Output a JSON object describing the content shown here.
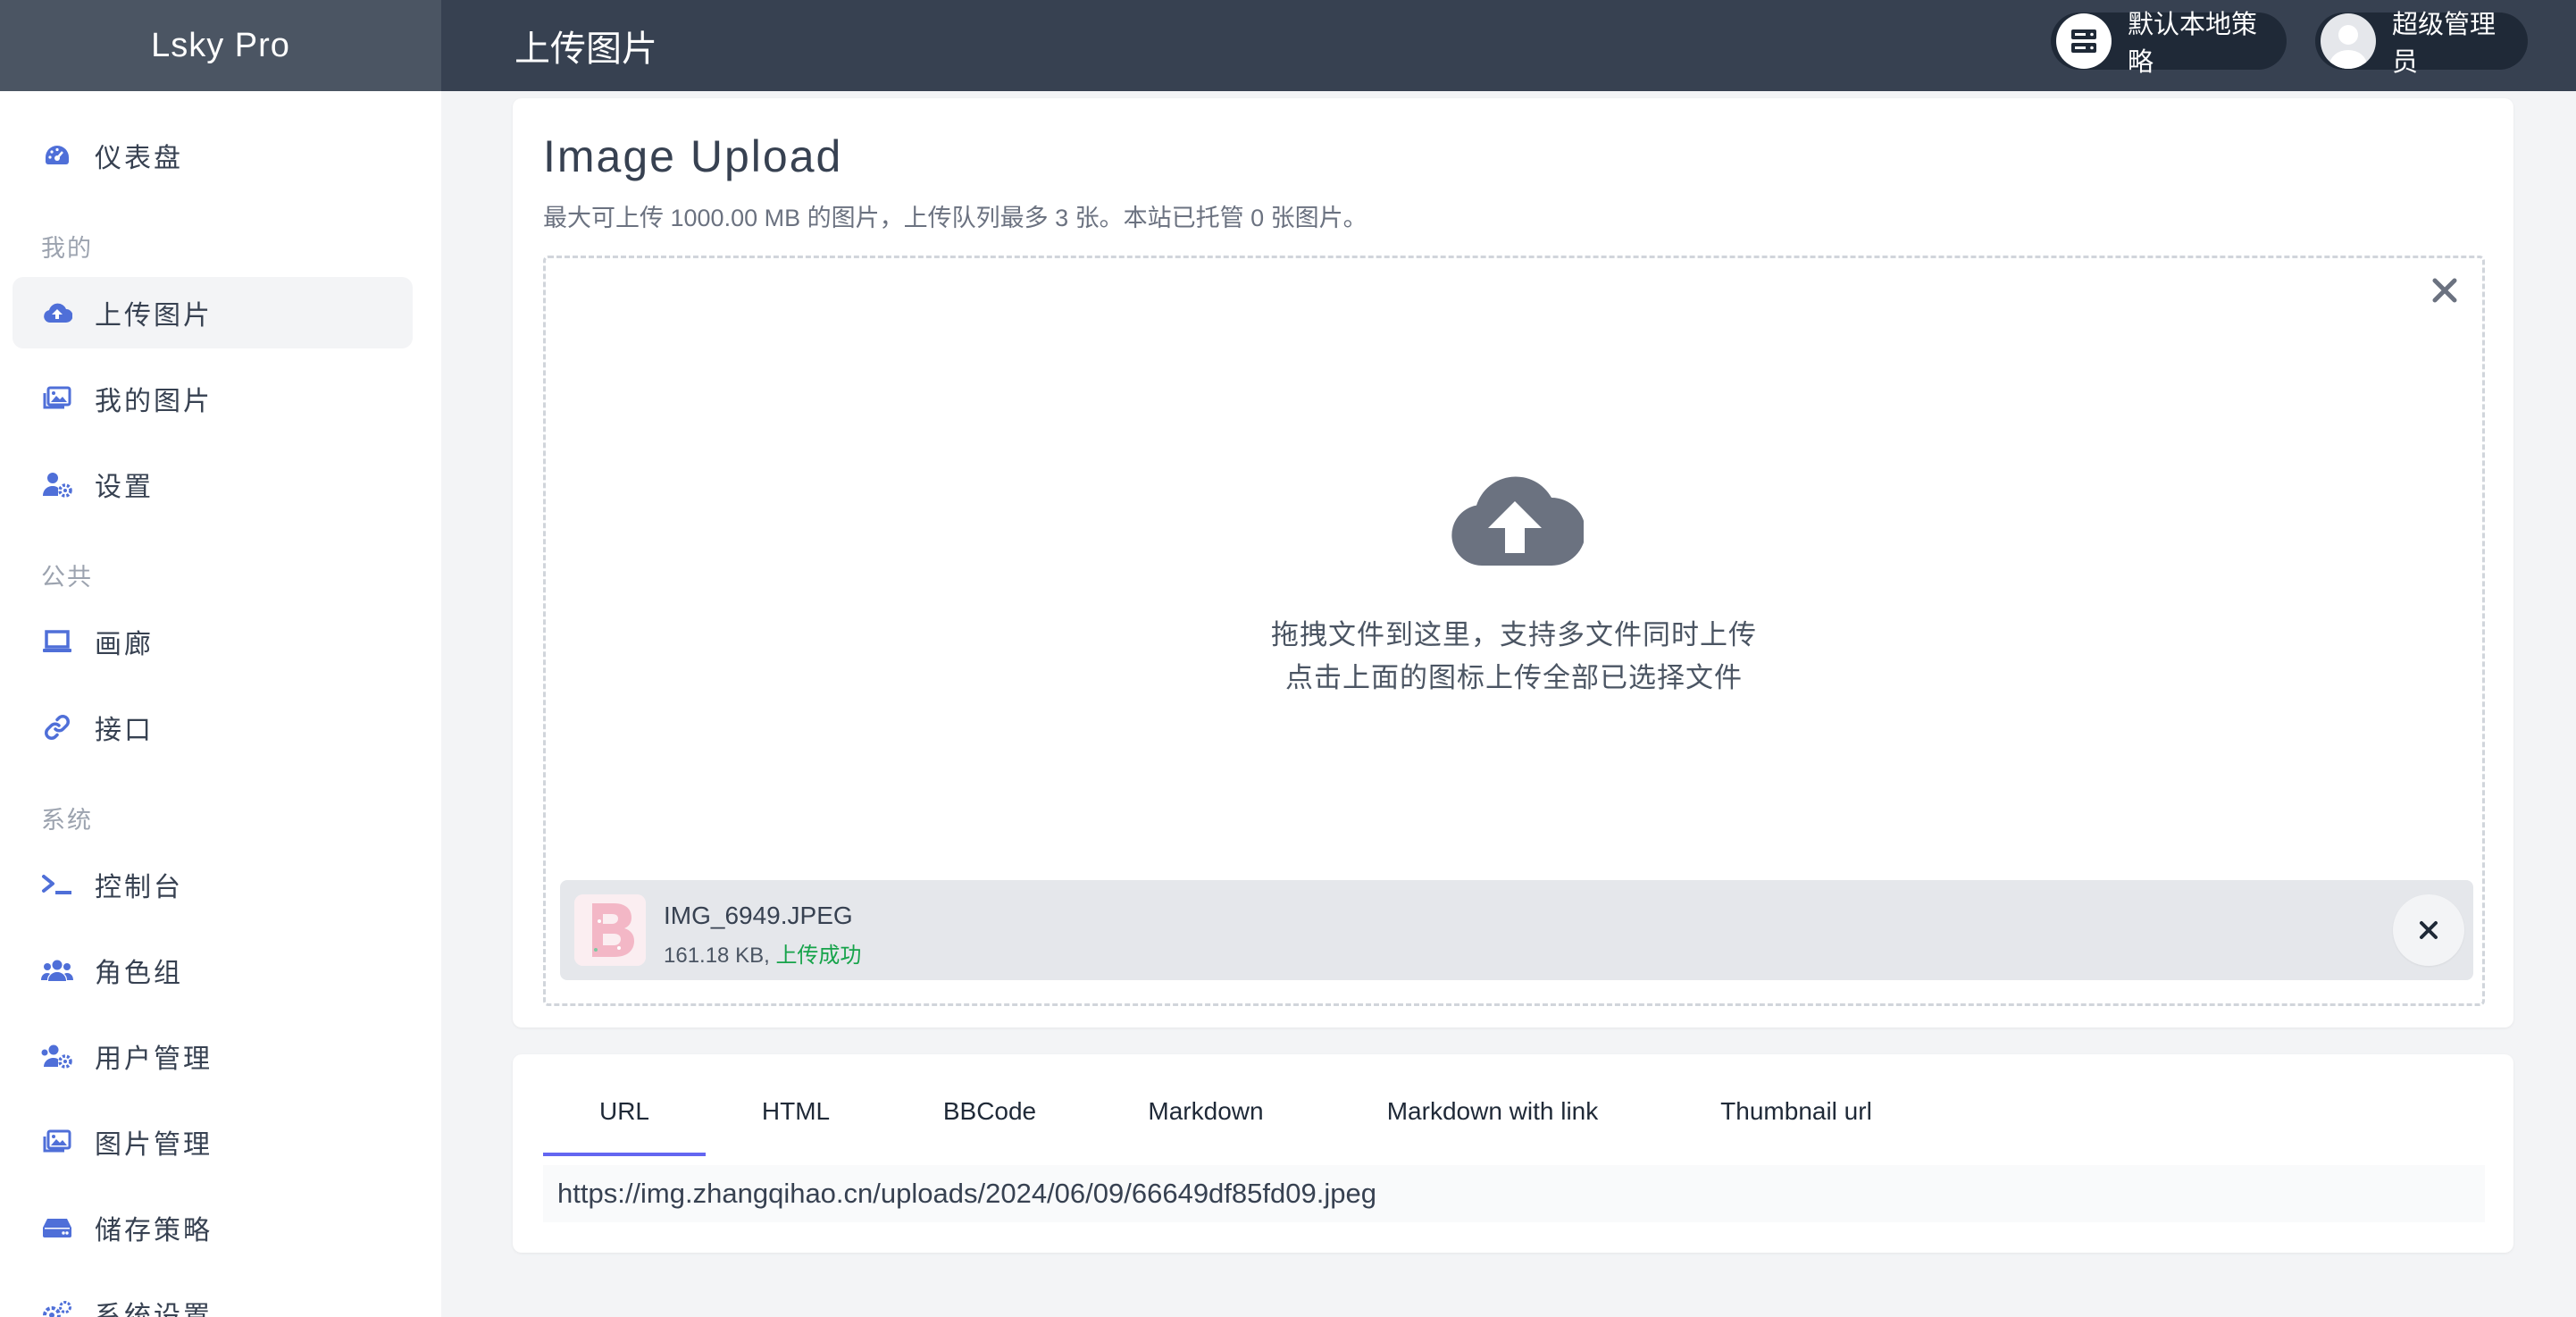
{
  "app": {
    "brand": "Lsky Pro",
    "page_title": "上传图片"
  },
  "header": {
    "strategy_label": "默认本地策略",
    "user_name": "超级管理员"
  },
  "sidebar": {
    "dashboard": "仪表盘",
    "section_mine": "我的",
    "upload": "上传图片",
    "my_images": "我的图片",
    "settings": "设置",
    "section_public": "公共",
    "gallery": "画廊",
    "api": "接口",
    "section_system": "系统",
    "console": "控制台",
    "roles": "角色组",
    "users": "用户管理",
    "image_manage": "图片管理",
    "storage": "储存策略",
    "system_settings": "系统设置"
  },
  "upload": {
    "title": "Image Upload",
    "description": "最大可上传 1000.00 MB 的图片，上传队列最多 3 张。本站已托管 0 张图片。",
    "drop_line1": "拖拽文件到这里，支持多文件同时上传",
    "drop_line2": "点击上面的图标上传全部已选择文件",
    "file": {
      "name": "IMG_6949.JPEG",
      "size": "161.18 KB,",
      "status": "上传成功"
    }
  },
  "links": {
    "tabs": [
      "URL",
      "HTML",
      "BBCode",
      "Markdown",
      "Markdown with link",
      "Thumbnail url"
    ],
    "active_tab": "URL",
    "value": "https://img.zhangqihao.cn/uploads/2024/06/09/66649df85fd09.jpeg"
  },
  "colors": {
    "topbar": "#374151",
    "brand_bg": "#4b5563",
    "accent": "#6366f1",
    "icon_blue": "#4f6fd8",
    "success": "#16a34a"
  }
}
